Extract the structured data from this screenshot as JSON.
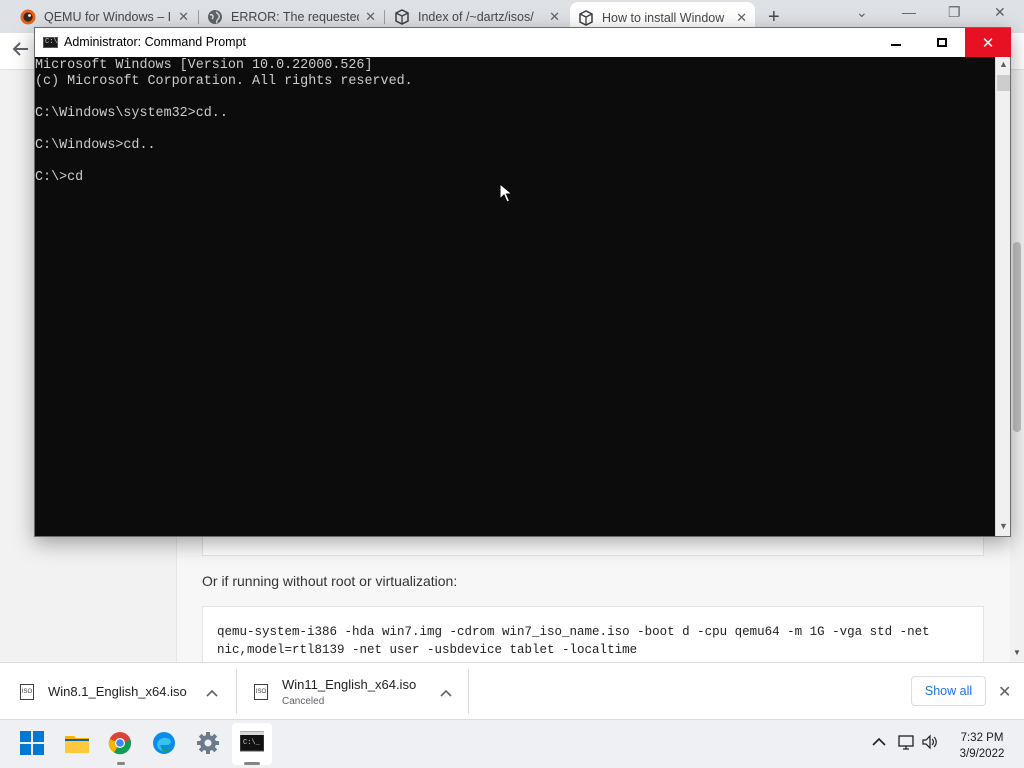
{
  "browser": {
    "tabs": [
      {
        "title": "QEMU for Windows – I",
        "icon": "qemu-icon"
      },
      {
        "title": "ERROR: The requested",
        "icon": "globe-icon"
      },
      {
        "title": "Index of /~dartz/isos/",
        "icon": "server-icon"
      },
      {
        "title": "How to install Window",
        "icon": "server-icon"
      }
    ],
    "new_tab": "+",
    "page": {
      "paragraph": "Or if running without root or virtualization:",
      "code_lines": [
        "qemu-system-i386 -hda win7.img -cdrom win7_iso_name.iso -boot d -cpu qemu64 -m 1G -vga std -net",
        "nic,model=rtl8139 -net user -usbdevice tablet -localtime"
      ]
    }
  },
  "cmd": {
    "title": "Administrator: Command Prompt",
    "icon_text": "C:\\",
    "lines": [
      "Microsoft Windows [Version 10.0.22000.526]",
      "(c) Microsoft Corporation. All rights reserved.",
      "",
      "C:\\Windows\\system32>cd..",
      "",
      "C:\\Windows>cd..",
      "",
      "C:\\>cd"
    ],
    "close_glyph": "✕"
  },
  "downloads": {
    "items": [
      {
        "name": "Win8.1_English_x64.iso",
        "status": ""
      },
      {
        "name": "Win11_English_x64.iso",
        "status": "Canceled"
      }
    ],
    "file_icon_text": "ISO",
    "show_all": "Show all",
    "close_glyph": "✕"
  },
  "taskbar": {
    "apps": [
      "start-icon",
      "file-explorer-icon",
      "chrome-icon",
      "edge-icon",
      "settings-icon",
      "terminal-icon"
    ],
    "time": "7:32 PM",
    "date": "3/9/2022"
  },
  "colors": {
    "close_red": "#e81123",
    "console_bg": "#0c0c0c",
    "console_text": "#cccccc",
    "link_blue": "#1a73e8"
  }
}
